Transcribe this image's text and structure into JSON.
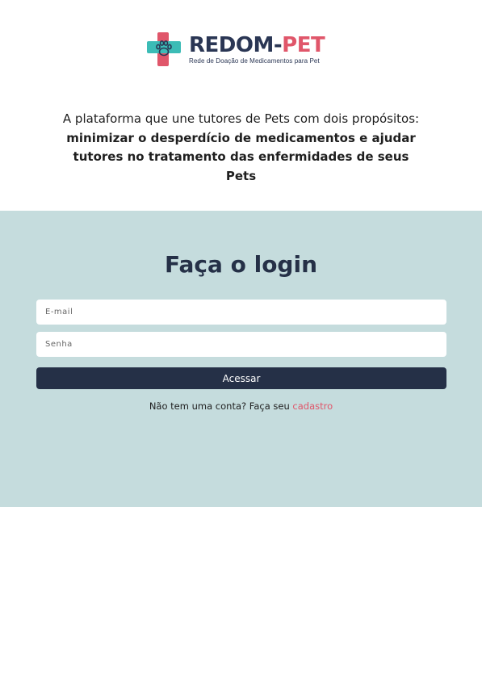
{
  "brand": {
    "name_main": "REDOM-",
    "name_accent": "PET",
    "subtitle": "Rede de Doação de Medicamentos para Pet",
    "logo_icon": "paw-cross-icon",
    "colors": {
      "navy": "#253047",
      "coral": "#e0566a",
      "teal": "#3cbcb6",
      "panel": "#c5dcdd"
    }
  },
  "tagline": {
    "normal": "A plataforma que une tutores de Pets com dois propósitos: ",
    "bold": "minimizar o desperdício de medicamentos e ajudar tutores no tratamento das enfermidades de seus Pets"
  },
  "login": {
    "title": "Faça o login",
    "email_placeholder": "E-mail",
    "email_value": "",
    "password_placeholder": "Senha",
    "password_value": "",
    "submit_label": "Acessar",
    "signup_prompt": "Não tem uma conta? Faça seu ",
    "signup_link": "cadastro"
  }
}
